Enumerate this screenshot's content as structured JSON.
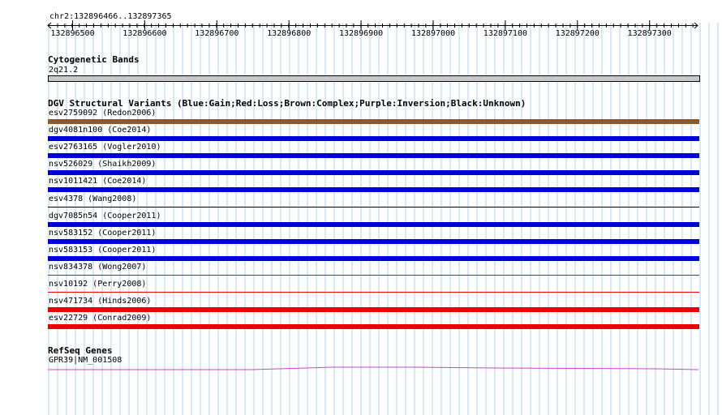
{
  "ruler": {
    "range_label": "chr2:132896466..132897365",
    "ticks": [
      "132896500",
      "132896600",
      "132896700",
      "132896800",
      "132896900",
      "132897000",
      "132897100",
      "132897200",
      "132897300"
    ]
  },
  "cyto": {
    "title": "Cytogenetic Bands",
    "band_label": "2q21.2"
  },
  "dgv": {
    "title": "DGV Structural Variants (Blue:Gain;Red:Loss;Brown:Complex;Purple:Inversion;Black:Unknown)",
    "colors": {
      "gain": "#0000dd",
      "loss": "#ee0000",
      "complex": "#8b5a2b",
      "unknown": "#000000"
    },
    "variants": [
      {
        "label": "esv2759092 (Redon2006)",
        "type": "complex",
        "bar": "thick"
      },
      {
        "label": "dgv4081n100 (Coe2014)",
        "type": "gain",
        "bar": "thick"
      },
      {
        "label": "esv2763165 (Vogler2010)",
        "type": "gain",
        "bar": "thick"
      },
      {
        "label": "nsv526029 (Shaikh2009)",
        "type": "gain",
        "bar": "thick"
      },
      {
        "label": "nsv1011421 (Coe2014)",
        "type": "gain",
        "bar": "thick"
      },
      {
        "label": "esv4378 (Wang2008)",
        "type": "unknown",
        "bar": "thin"
      },
      {
        "label": "dgv7085n54 (Cooper2011)",
        "type": "gain",
        "bar": "thick"
      },
      {
        "label": "nsv583152 (Cooper2011)",
        "type": "gain",
        "bar": "thick"
      },
      {
        "label": "nsv583153 (Cooper2011)",
        "type": "gain",
        "bar": "thick"
      },
      {
        "label": "nsv834378 (Wong2007)",
        "type": "loss",
        "bar": "thin"
      },
      {
        "label": "nsv10192 (Perry2008)",
        "type": "loss",
        "bar": "thin"
      },
      {
        "label": "nsv471734 (Hinds2006)",
        "type": "loss",
        "bar": "thick"
      },
      {
        "label": "esv22729 (Conrad2009)",
        "type": "loss",
        "bar": "thick"
      }
    ]
  },
  "refseq": {
    "title": "RefSeq Genes",
    "gene_label": "GPR39|NM_001508",
    "color": "#cc44cc"
  }
}
